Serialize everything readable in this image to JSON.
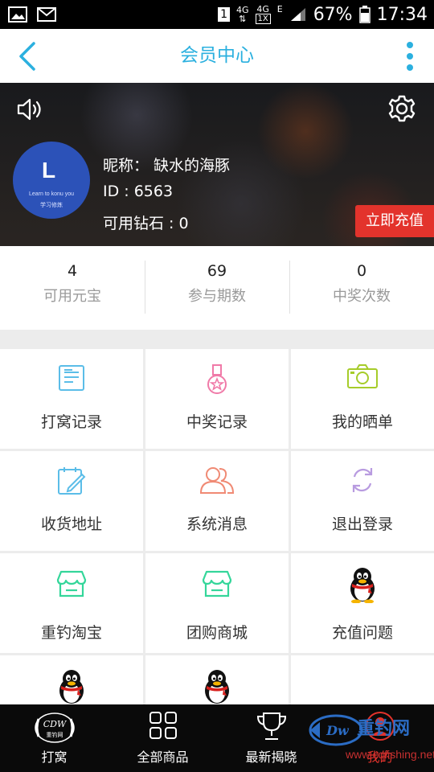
{
  "status_bar": {
    "sim_slot": "1",
    "net_1": "4G",
    "net_2_top": "4G",
    "net_2_box": "1X",
    "edge": "E",
    "battery_percent": "67%",
    "time": "17:34"
  },
  "header": {
    "title": "会员中心"
  },
  "profile": {
    "avatar_letter": "L",
    "avatar_caption": "Learn to konu you",
    "avatar_sub": "学习修炼",
    "nickname": "昵称： 缺水的海豚",
    "id": "ID : 6563",
    "diamonds": "可用钻石 : 0",
    "recharge_label": "立即充值"
  },
  "stats": [
    {
      "value": "4",
      "label": "可用元宝"
    },
    {
      "value": "69",
      "label": "参与期数"
    },
    {
      "value": "0",
      "label": "中奖次数"
    }
  ],
  "menu": [
    {
      "label": "打窝记录",
      "icon": "document-icon",
      "color": "#5bbde8"
    },
    {
      "label": "中奖记录",
      "icon": "medal-icon",
      "color": "#f07aa8"
    },
    {
      "label": "我的晒单",
      "icon": "camera-icon",
      "color": "#a6cc2a"
    },
    {
      "label": "收货地址",
      "icon": "edit-calendar-icon",
      "color": "#5bbde8"
    },
    {
      "label": "系统消息",
      "icon": "users-icon",
      "color": "#f08a74"
    },
    {
      "label": "退出登录",
      "icon": "refresh-icon",
      "color": "#b89be0"
    },
    {
      "label": "重钓淘宝",
      "icon": "store-icon",
      "color": "#34d69a"
    },
    {
      "label": "团购商城",
      "icon": "store-icon",
      "color": "#34d69a"
    },
    {
      "label": "充值问题",
      "icon": "qq-penguin-icon",
      "color": "#000000"
    },
    {
      "label": "",
      "icon": "qq-penguin-icon",
      "color": "#000000"
    },
    {
      "label": "",
      "icon": "qq-penguin-icon",
      "color": "#000000"
    }
  ],
  "nav": [
    {
      "label": "打窝",
      "icon": "brand-logo-icon"
    },
    {
      "label": "全部商品",
      "icon": "grid-icon"
    },
    {
      "label": "最新揭晓",
      "icon": "trophy-icon"
    },
    {
      "label": "我的",
      "icon": "user-icon"
    }
  ],
  "watermark": {
    "brand": "重钓网",
    "url": "www.cqfishing.net"
  },
  "colors": {
    "accent": "#2bb0df",
    "recharge": "#e3332c"
  }
}
